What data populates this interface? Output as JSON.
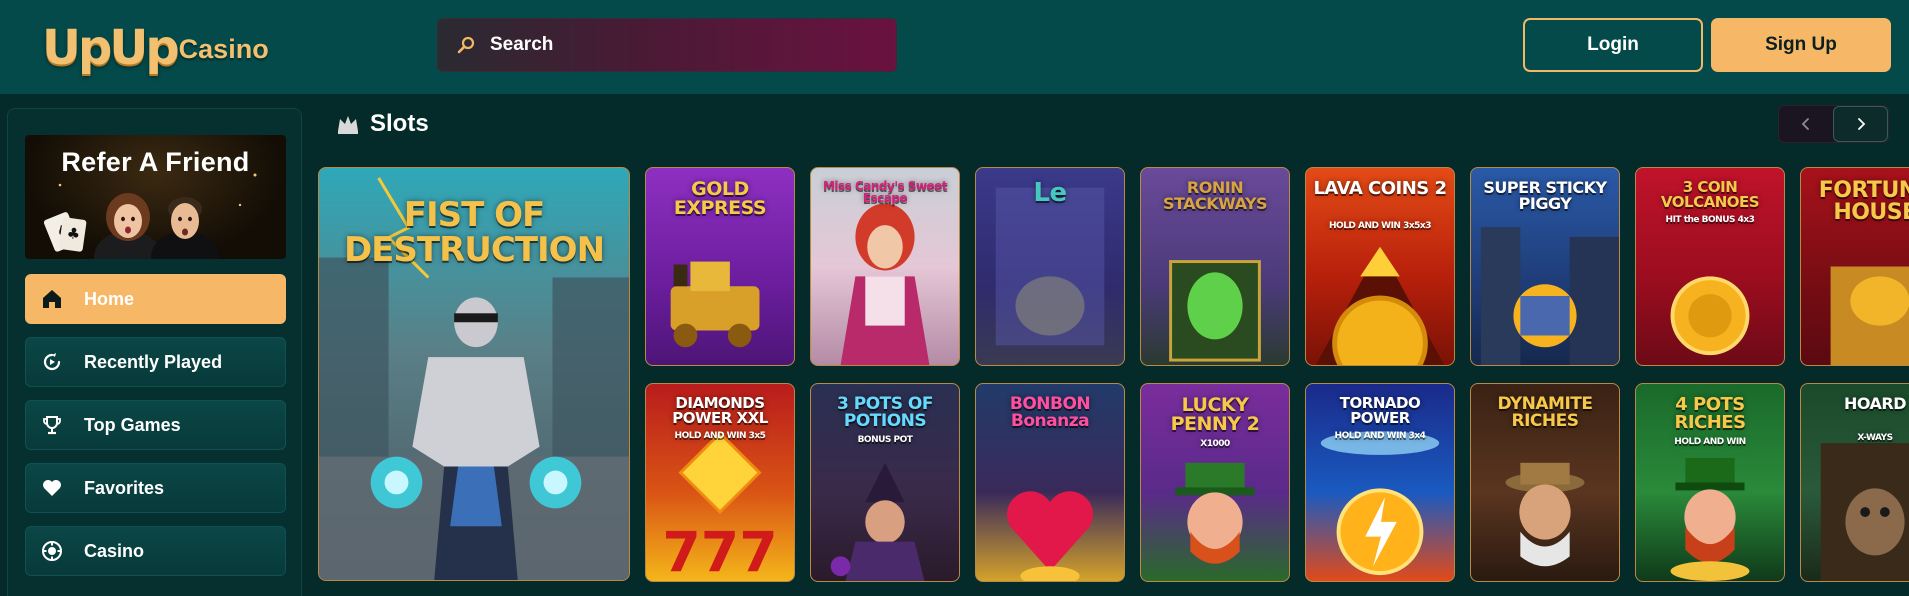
{
  "brand": {
    "logo_main": "UpUp",
    "logo_sub": "Casino"
  },
  "header": {
    "search_placeholder": "Search",
    "login_label": "Login",
    "signup_label": "Sign Up"
  },
  "sidebar": {
    "promo_title": "Refer A Friend",
    "items": [
      {
        "label": "Home",
        "icon": "home-icon",
        "active": true
      },
      {
        "label": "Recently Played",
        "icon": "recent-icon",
        "active": false
      },
      {
        "label": "Top Games",
        "icon": "trophy-icon",
        "active": false
      },
      {
        "label": "Favorites",
        "icon": "heart-icon",
        "active": false
      },
      {
        "label": "Casino",
        "icon": "casino-chip-icon",
        "active": false
      }
    ]
  },
  "slots": {
    "title": "Slots",
    "featured": {
      "name": "FIST OF DESTRUCTION"
    },
    "row1": [
      {
        "name": "GOLD EXPRESS"
      },
      {
        "name": "Miss Candy's Sweet Escape"
      },
      {
        "name": "Le"
      },
      {
        "name": "RONIN STACKWAYS"
      },
      {
        "name": "LAVA COINS 2",
        "tag": "HOLD AND WIN 3x5x3"
      },
      {
        "name": "SUPER STICKY PIGGY"
      },
      {
        "name": "3 COIN VOLCANOES",
        "tag": "HIT the BONUS 4x3"
      },
      {
        "name": "FORTUNE HOUSE"
      }
    ],
    "row2": [
      {
        "name": "DIAMONDS POWER XXL",
        "tag": "HOLD AND WIN 3x5"
      },
      {
        "name": "3 POTS OF POTIONS",
        "tag": "BONUS POT"
      },
      {
        "name": "BONBON Bonanza"
      },
      {
        "name": "LUCKY PENNY 2",
        "tag": "X1000"
      },
      {
        "name": "TORNADO POWER",
        "tag": "HOLD AND WIN 3x4"
      },
      {
        "name": "DYNAMITE RICHES"
      },
      {
        "name": "4 POTS RICHES",
        "tag": "HOLD AND WIN"
      },
      {
        "name": "HOARD",
        "tag": "X-WAYS"
      }
    ]
  },
  "colors": {
    "header_bg": "#044a4a",
    "page_bg": "#052a2a",
    "accent": "#f6b766"
  }
}
